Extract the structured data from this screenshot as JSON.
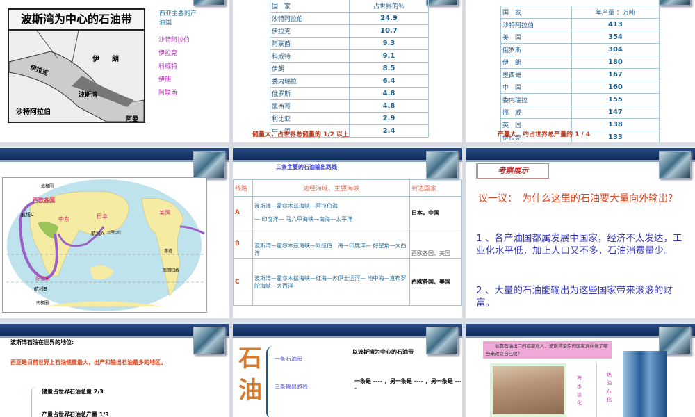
{
  "slide1": {
    "map_title": "波斯湾为中心的石油带",
    "map_labels": [
      "伊朗",
      "伊拉克",
      "沙特阿拉伯",
      "阿曼",
      "波斯湾"
    ],
    "heading": "西亚主要的产油国",
    "countries": [
      "沙特阿拉伯",
      "伊拉克",
      "科威特",
      "伊朗",
      "阿联酋"
    ]
  },
  "slide2": {
    "headers": [
      "国　家",
      "占世界的％"
    ],
    "rows": [
      [
        "沙特阿拉伯",
        "24.9"
      ],
      [
        "伊拉克",
        "10.7"
      ],
      [
        "阿联酋",
        "9.3"
      ],
      [
        "科威特",
        "9.1"
      ],
      [
        "伊朗",
        "8.5"
      ],
      [
        "委内瑞拉",
        "6.4"
      ],
      [
        "俄罗斯",
        "4.8"
      ],
      [
        "墨西哥",
        "4.8"
      ],
      [
        "利比亚",
        "2.9"
      ],
      [
        "中　国",
        "2.4"
      ]
    ],
    "note": "储量大，占世界总储量的 1/2 以上"
  },
  "slide3": {
    "headers": [
      "国　家",
      "年产量 ：万吨"
    ],
    "rows": [
      [
        "沙特阿拉伯",
        "413"
      ],
      [
        "美　国",
        "354"
      ],
      [
        "俄罗斯",
        "304"
      ],
      [
        "伊　朗",
        "180"
      ],
      [
        "墨西哥",
        "167"
      ],
      [
        "中　国",
        "160"
      ],
      [
        "委内瑞拉",
        "155"
      ],
      [
        "挪　威",
        "147"
      ],
      [
        "英　国",
        "138"
      ],
      [
        "伊拉克",
        "133"
      ]
    ],
    "note": "产量大，约占世界总产量的 1 / 4"
  },
  "slide4": {
    "labels": {
      "north_circle": "北极圈",
      "west_europe": "西欧各国",
      "route_c": "航线C",
      "middle_east": "中东",
      "japan": "日本",
      "usa": "美国",
      "route_a": "航线A",
      "tropic_n": "北回归线",
      "equator": "赤道",
      "tropic_s": "南回归线",
      "cape": "好望角",
      "route_b": "航线B",
      "south_circle": "南极圈"
    }
  },
  "slide5": {
    "title": "三条主要的石油输出路线",
    "headers": [
      "线路",
      "途经海域、主要海峡",
      "到达国家"
    ],
    "rows": [
      {
        "line": "A",
        "route1": "波斯湾—霍尔木兹海峡—阿拉伯海",
        "route2": "— 印度洋— 马六甲海峡—南海—太平洋",
        "dest": "日本，中国"
      },
      {
        "line": "B",
        "route1": "波斯湾—霍尔木兹海峡—阿拉伯　海—印度洋— 好望角—大西洋",
        "route2": "",
        "dest": "西欧各国、美国"
      },
      {
        "line": "C",
        "route1": "波斯湾—霍尔木兹海峡—红海—苏伊士运河— 地中海—直布罗陀海峡—大西洋",
        "route2": "",
        "dest": "西欧各国、美国"
      }
    ]
  },
  "slide6": {
    "tag": "考察展示",
    "question": "议一议：　为什么这里的石油要大量向外输出？",
    "answer1": "1 、各产油国都属发展中国家，经济不太发达，工业化水平低，加上人口又不多，石油消费量少。",
    "answer2": "2 、大量的石油能输出为这些国家带来滚滚的财富。"
  },
  "slide7": {
    "title": "波斯湾石油在世界的地位:",
    "statement": "西亚是目前世界上石油储量最大，出产和输出石油最多的地区。",
    "item1": "储量占世界石油总量 2/3",
    "item2": "产量占世界石油总产量 1/3"
  },
  "slide8": {
    "big": "石油",
    "branch1": "一条石油带",
    "branch2": "三条输出路线",
    "text1": "以波斯湾为中心的石油带",
    "text2": "一条是 ---- ，另一条是 ---- ，另一条是 ----"
  },
  "slide9": {
    "question": "依靠石油出口的巨额收入，波斯湾沿岸的国家具体做了哪些来改变自己呢？",
    "label1": "海水淡化",
    "label2": "炼油石化"
  }
}
